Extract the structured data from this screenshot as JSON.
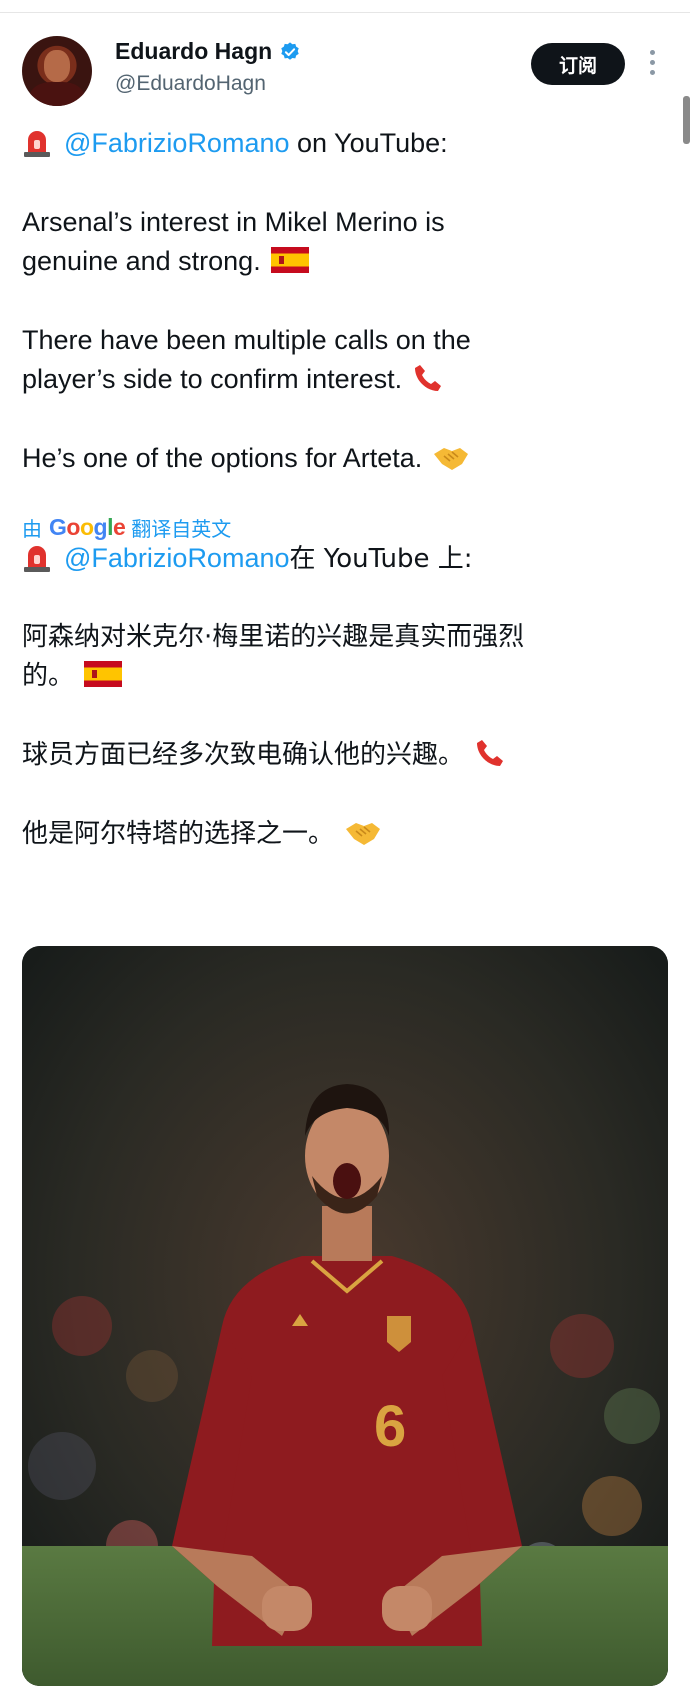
{
  "author": {
    "name": "Eduardo Hagn",
    "handle": "@EduardoHagn",
    "verified": true,
    "avatar_icon": "avatar-photo"
  },
  "subscribe_label": "订阅",
  "more_icon": "more-vertical-icon",
  "tweet": {
    "lines": [
      {
        "mention": "@FabrizioRomano",
        "rest": " on YouTube:",
        "icon": "siren-emoji"
      },
      {
        "text": "Arsenal’s interest in Mikel Merino is"
      },
      {
        "text": "genuine and strong.",
        "icon": "spain-flag-emoji"
      },
      {
        "text": "There have been multiple calls on the"
      },
      {
        "text": "player’s side to confirm interest.",
        "icon": "telephone-emoji"
      },
      {
        "text": "He’s one of the options for Arteta.",
        "icon": "handshake-emoji"
      }
    ]
  },
  "translate": {
    "prefix": "由",
    "brand": "Google",
    "suffix": "翻译自英文"
  },
  "translated": {
    "lines": [
      {
        "mention": "@FabrizioRomano",
        "rest": "在 YouTube 上:",
        "icon": "siren-emoji"
      },
      {
        "text": "阿森纳对米克尔·梅里诺的兴趣是真实而强烈"
      },
      {
        "text": "的。",
        "icon": "spain-flag-emoji"
      },
      {
        "text": "球员方面已经多次致电确认他的兴趣。",
        "icon": "telephone-emoji"
      },
      {
        "text": "他是阿尔特塔的选择之一。",
        "icon": "handshake-emoji"
      }
    ]
  },
  "media": {
    "jersey_number": "6",
    "colors": {
      "jersey": "#8e1b1f",
      "accent": "#d9a441",
      "pitch": "#4f6b3a"
    }
  },
  "colors": {
    "link": "#1d9bf0",
    "text": "#0f1419",
    "muted": "#536471",
    "button_bg": "#0f1419"
  }
}
